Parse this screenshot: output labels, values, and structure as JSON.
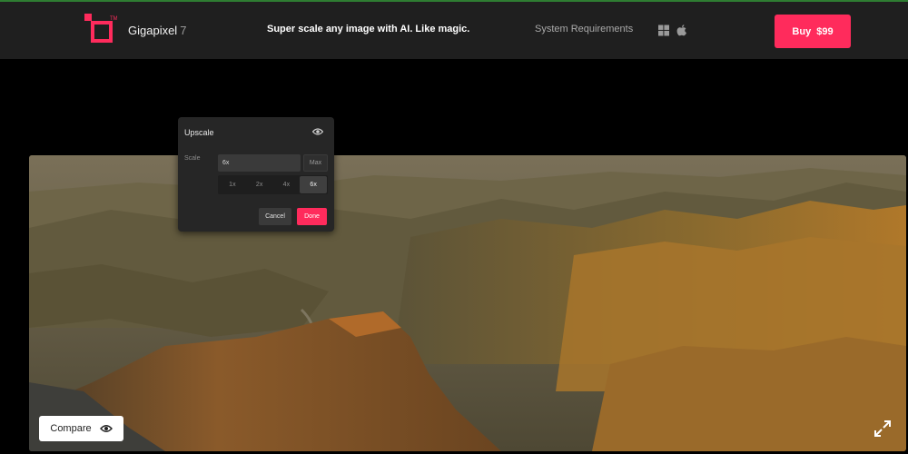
{
  "header": {
    "brand_name": "Gigapixel",
    "brand_version": "7",
    "tagline": "Super scale any image with AI. Like magic.",
    "system_requirements": "System Requirements",
    "buy_label": "Buy",
    "buy_price": "$99",
    "os_icons": [
      "windows-icon",
      "apple-icon"
    ]
  },
  "upscale_panel": {
    "title": "Upscale",
    "scale_label": "Scale",
    "scale_value": "6x",
    "max_label": "Max",
    "scale_options": [
      "1x",
      "2x",
      "4x",
      "6x"
    ],
    "selected_scale": "6x",
    "cancel_label": "Cancel",
    "done_label": "Done"
  },
  "image_view": {
    "compare_label": "Compare",
    "image_subject": "canyon landscape photo"
  },
  "colors": {
    "accent": "#ff2b5c",
    "header_bg": "#1f1f1f",
    "page_bg": "#000000",
    "panel_bg": "#262626"
  }
}
